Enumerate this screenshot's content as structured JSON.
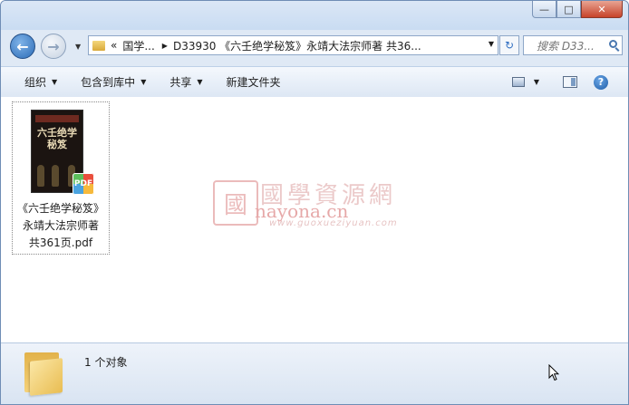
{
  "window": {
    "controls": {
      "minimize": "—",
      "maximize": "□",
      "close": "✕"
    }
  },
  "nav": {
    "back_icon": "arrow-left-icon",
    "forward_icon": "arrow-right-icon",
    "address": {
      "overflow": "«",
      "crumb1": "国学...",
      "crumb2": "D33930 《六壬绝学秘笈》永靖大法宗师著  共36..."
    },
    "refresh_glyph": "↻",
    "search_placeholder": "搜索 D33..."
  },
  "toolbar": {
    "organize": "组织",
    "include_library": "包含到库中",
    "share": "共享",
    "new_folder": "新建文件夹",
    "help": "?"
  },
  "file": {
    "name_line1": "《六壬绝学秘笈》",
    "name_line2": "永靖大法宗师著",
    "name_line3": "共361页.pdf",
    "thumb_title": "六壬绝学秘笈",
    "badge": "PDF"
  },
  "watermark": {
    "seal": "國",
    "cn": "國學資源網",
    "site": "nayona.cn",
    "url": "www.guoxueziyuan.com"
  },
  "status": {
    "count": "1 个对象"
  }
}
